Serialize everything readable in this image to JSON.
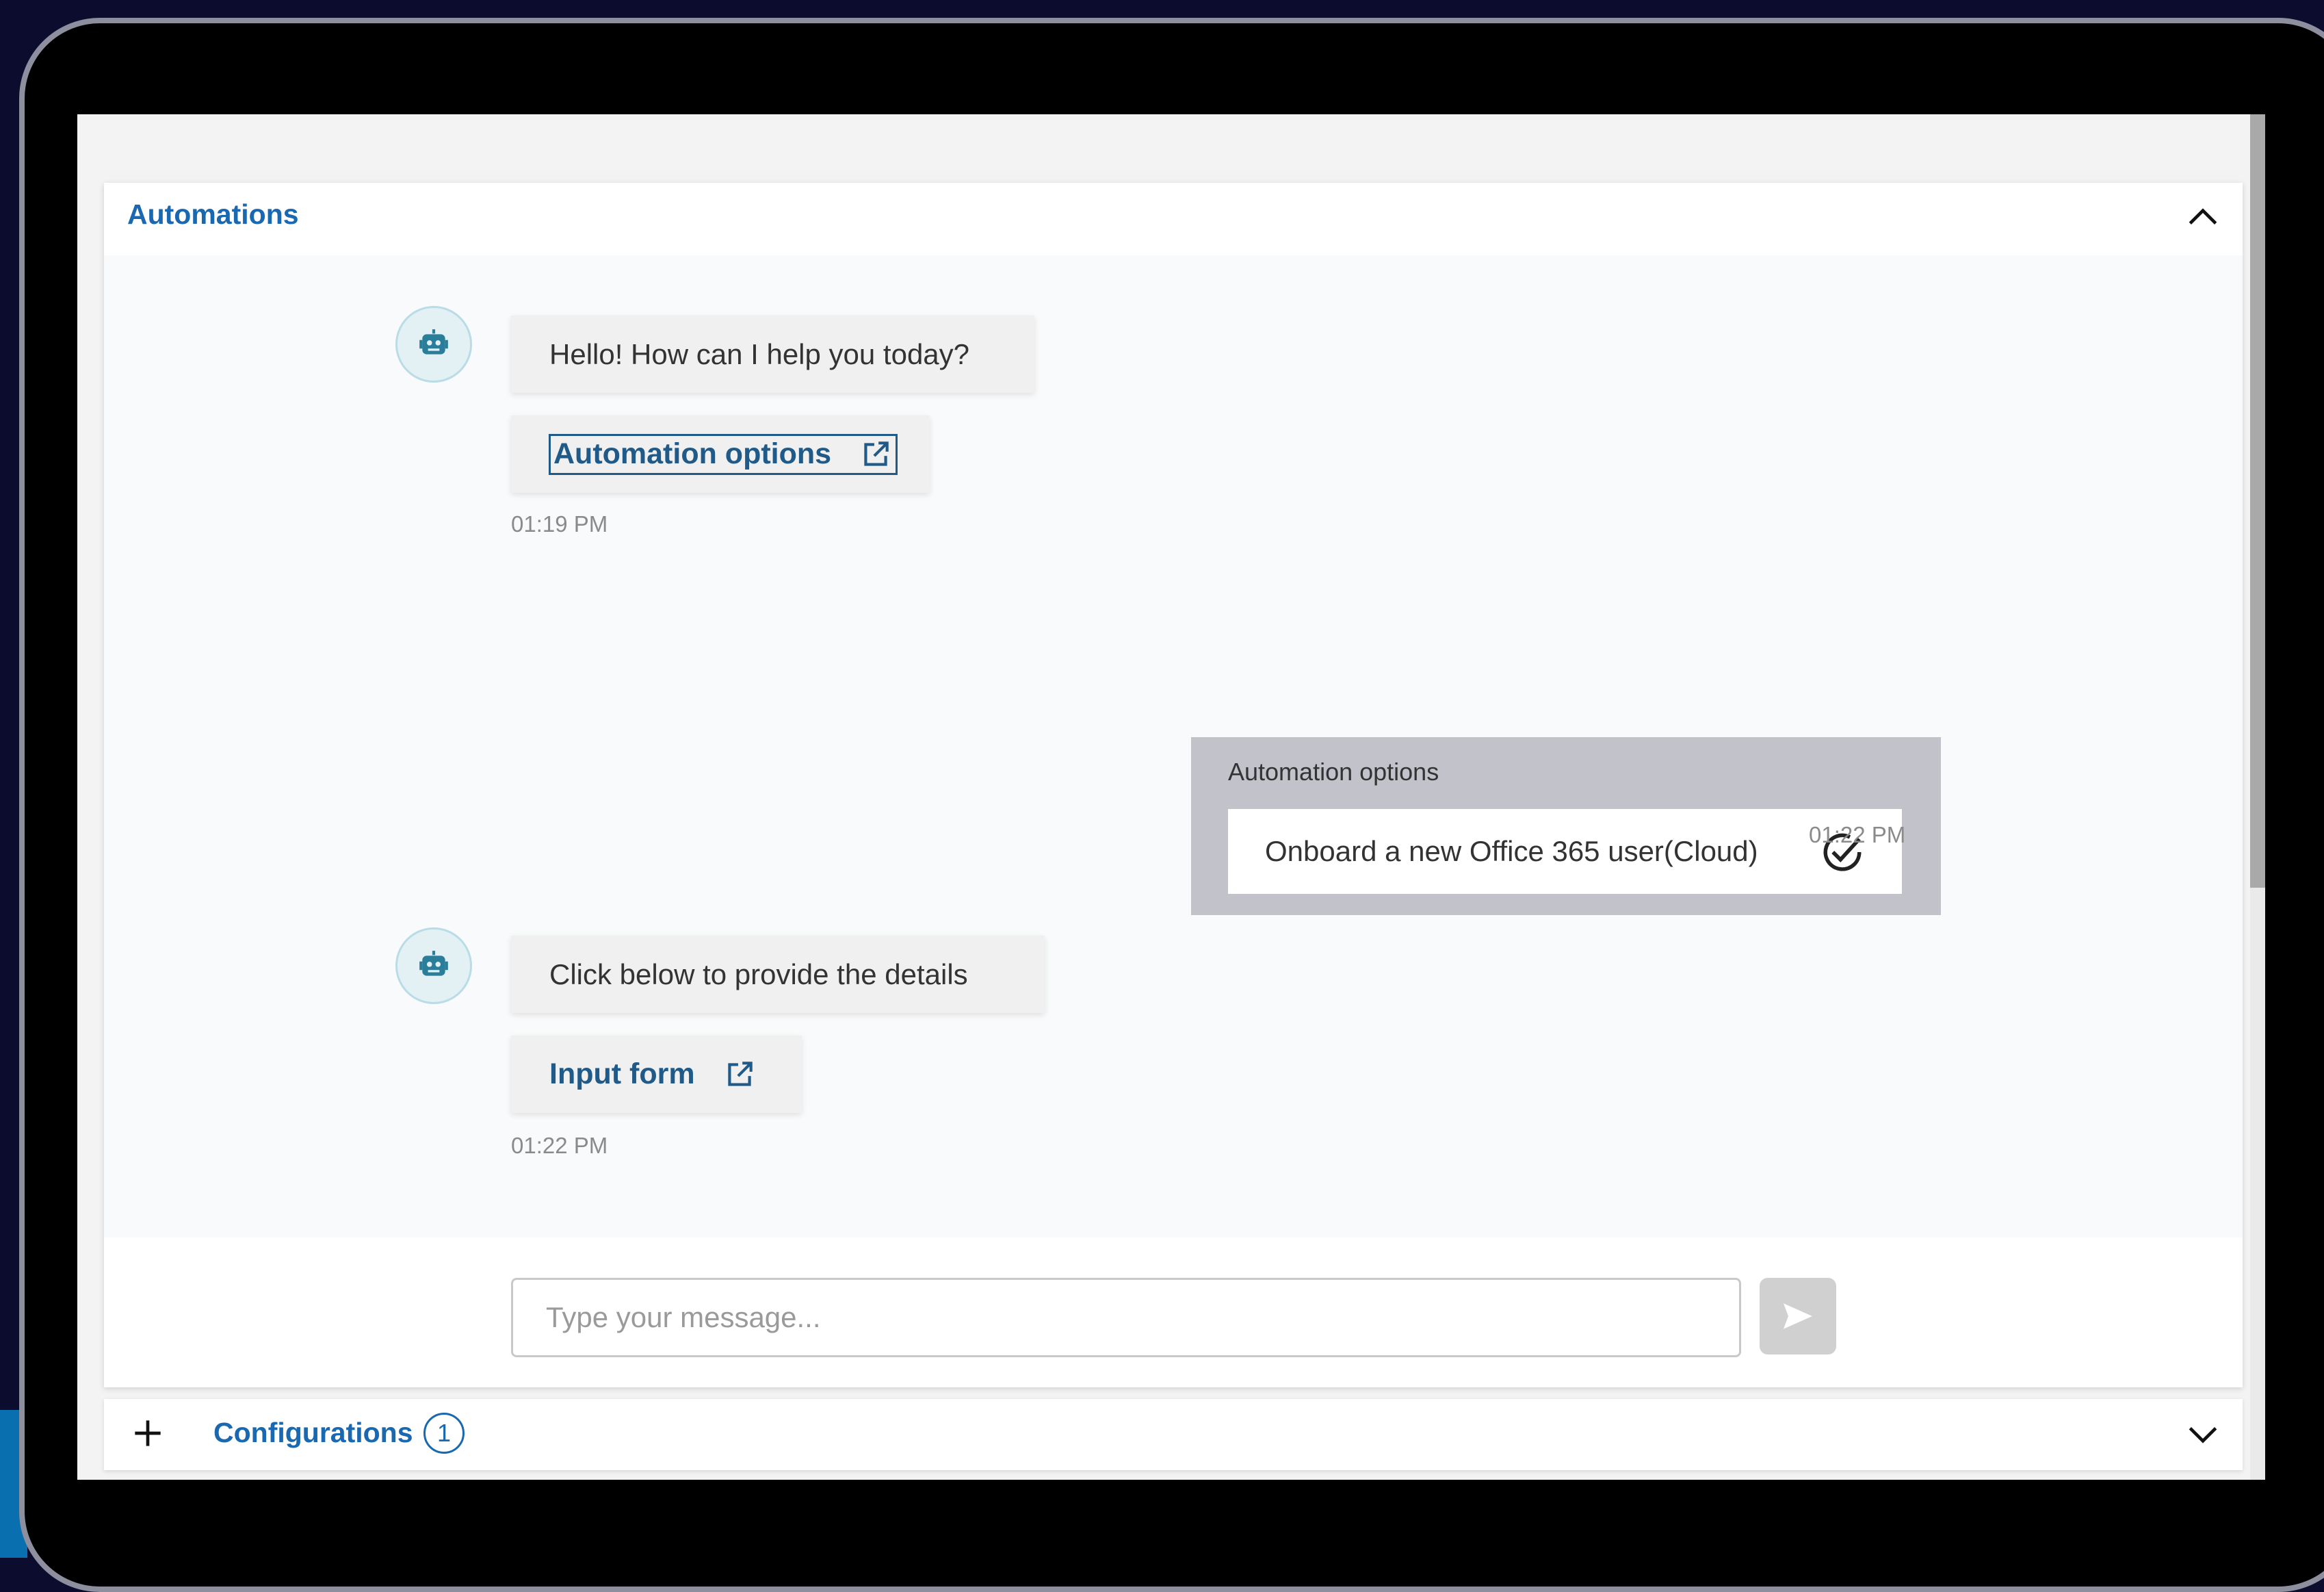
{
  "panel": {
    "title": "Automations"
  },
  "messages": {
    "bot1": {
      "text": "Hello! How can I help you today?",
      "link_label": "Automation options",
      "time": "01:19 PM"
    },
    "user1": {
      "label": "Automation options",
      "choice": "Onboard a new Office 365 user(Cloud)",
      "time": "01:22 PM"
    },
    "bot2": {
      "text": "Click below to provide the details",
      "link_label": "Input form",
      "time": "01:22 PM"
    }
  },
  "composer": {
    "placeholder": "Type your message..."
  },
  "configurations": {
    "title": "Configurations",
    "count": "1"
  },
  "colors": {
    "accent": "#1a68b0",
    "link": "#1f5a88",
    "user_card": "#c2c2cb"
  }
}
